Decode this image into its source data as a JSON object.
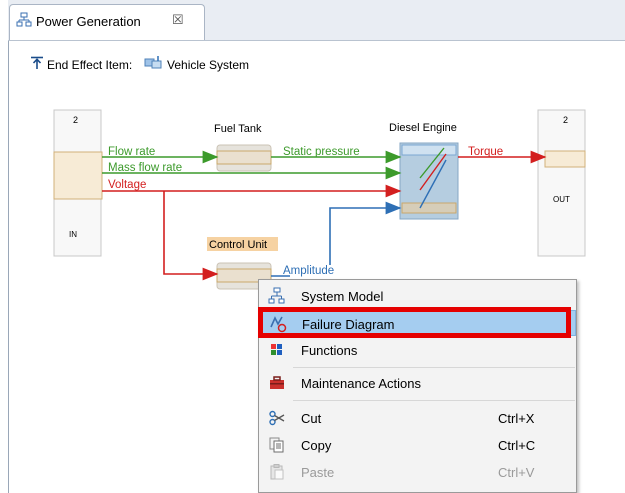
{
  "tab": {
    "title": "Power Generation",
    "close": "☒"
  },
  "header": {
    "end_effect_label": "End Effect Item:",
    "vehicle": "Vehicle System"
  },
  "diagram": {
    "in_port": {
      "number": "2",
      "label": "IN"
    },
    "out_port": {
      "number": "2",
      "label": "OUT"
    },
    "blocks": {
      "fuel_tank": "Fuel Tank",
      "diesel_engine": "Diesel Engine",
      "control_unit": "Control Unit"
    },
    "signals": {
      "flow_rate": "Flow rate",
      "mass_flow_rate": "Mass flow rate",
      "voltage": "Voltage",
      "static_pressure": "Static pressure",
      "torque": "Torque",
      "amplitude": "Amplitude"
    },
    "colors": {
      "green": "#3c9a2b",
      "red": "#d31f1f",
      "blue": "#2e6fb5"
    }
  },
  "context_menu": {
    "items": [
      {
        "label": "System Model",
        "icon": "system-model-icon",
        "shortcut": ""
      },
      {
        "label": "Failure Diagram",
        "icon": "failure-diagram-icon",
        "shortcut": "",
        "highlighted": true
      },
      {
        "label": "Functions",
        "icon": "functions-icon",
        "shortcut": ""
      },
      {
        "label": "Maintenance Actions",
        "icon": "toolbox-icon",
        "shortcut": ""
      },
      {
        "label": "Cut",
        "icon": "cut-icon",
        "shortcut": "Ctrl+X"
      },
      {
        "label": "Copy",
        "icon": "copy-icon",
        "shortcut": "Ctrl+C"
      },
      {
        "label": "Paste",
        "icon": "paste-icon",
        "shortcut": "Ctrl+V",
        "disabled": true
      }
    ]
  }
}
